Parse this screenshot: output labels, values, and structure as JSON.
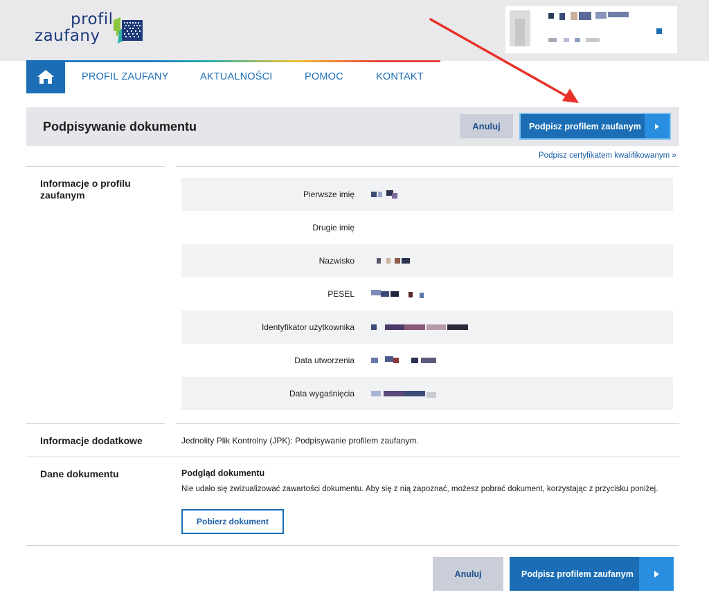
{
  "logo": {
    "line1": "profil",
    "line2": "zaufany"
  },
  "nav": {
    "home_icon": "home-icon",
    "items": [
      "PROFIL ZAUFANY",
      "AKTUALNOŚCI",
      "POMOC",
      "KONTAKT"
    ]
  },
  "header": {
    "title": "Podpisywanie dokumentu",
    "cancel_label": "Anuluj",
    "sign_label": "Podpisz profilem zaufanym",
    "cert_link": "Podpisz certyfikatem kwalifikowanym »"
  },
  "profile_section": {
    "label": "Informacje o profilu zaufanym",
    "fields": [
      {
        "label": "Pierwsze imię"
      },
      {
        "label": "Drugie imię"
      },
      {
        "label": "Nazwisko"
      },
      {
        "label": "PESEL"
      },
      {
        "label": "Identyfikator użytkownika"
      },
      {
        "label": "Data utworzenia"
      },
      {
        "label": "Data wygaśnięcia"
      }
    ]
  },
  "additional_section": {
    "label": "Informacje dodatkowe",
    "text": "Jednolity Plik Kontrolny (JPK): Podpisywanie profilem zaufanym."
  },
  "document_section": {
    "label": "Dane dokumentu",
    "preview_title": "Podgląd dokumentu",
    "preview_text": "Nie udało się zwizualizować zawartości dokumentu. Aby się z nią zapoznać, możesz pobrać dokument, korzystając z przycisku poniżej.",
    "download_label": "Pobierz dokument"
  },
  "footer_actions": {
    "cancel_label": "Anuluj",
    "sign_label": "Podpisz profilem zaufanym"
  },
  "colors": {
    "primary": "#1b6eb5",
    "accent": "#2a8ee0",
    "annotation_arrow": "#e8322a"
  }
}
